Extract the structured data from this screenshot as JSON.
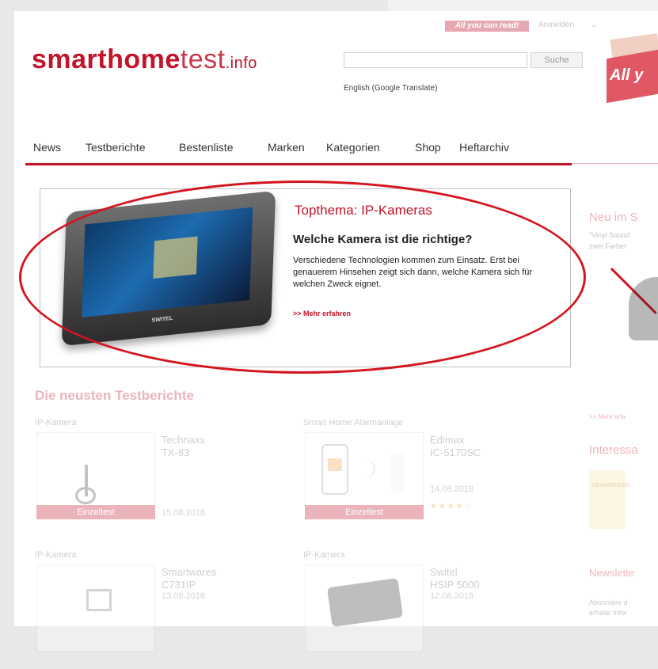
{
  "header": {
    "logo_bold": "smarthome",
    "logo_light": "test",
    "logo_suffix": ".info",
    "top_badge": "All you can read!",
    "login_label": "Anmelden",
    "search_placeholder": "",
    "search_button": "Suche",
    "translate_link": "English (Google Translate)",
    "promo_text": "All y"
  },
  "nav": {
    "items": [
      "News",
      "Testberichte",
      "Bestenliste",
      "Marken",
      "Kategorien",
      "Shop",
      "Heftarchiv"
    ]
  },
  "feature": {
    "kicker": "Topthema: IP-Kameras",
    "title": "Welche Kamera ist die richtige?",
    "text": "Verschiedene Technologien kommen zum Einsatz. Erst bei genauerem Hinsehen zeigt sich dann, welche Kamera sich für welchen Zweck eignet.",
    "link": ">> Mehr erfahren",
    "device_brand": "SWITEL"
  },
  "tests": {
    "title": "Die neusten Testberichte",
    "cards": [
      {
        "category": "IP-Kamera",
        "brand": "Technaxx",
        "model": "TX-83",
        "label": "Einzeltest",
        "date": "15.08.2018",
        "stars": ""
      },
      {
        "category": "Smart Home Alarmanlage",
        "brand": "Edimax",
        "model": "IC-5170SC",
        "label": "Einzeltest",
        "date": "14.08.2018",
        "stars": "★★★★☆"
      },
      {
        "category": "IP-Kamera",
        "brand": "Smartwares",
        "model": "C731IP",
        "label": "",
        "date": "13.08.2018",
        "stars": ""
      },
      {
        "category": "IP-Kamera",
        "brand": "Switel",
        "model": "HSIP 5000",
        "label": "",
        "date": "12.08.2018",
        "stars": ""
      }
    ]
  },
  "sidebar": {
    "new_title": "Neu im S",
    "new_subtitle_1": "\"Vinyl Sound",
    "new_subtitle_2": "zwei Farber",
    "more_link": ">> Mehr erfa",
    "interesting_title": "Interessa",
    "tile_text": "HEIMWERKER",
    "newsletter_title": "Newslette",
    "newsletter_text_1": "Abonniere d",
    "newsletter_text_2": "erhalte Infor"
  }
}
